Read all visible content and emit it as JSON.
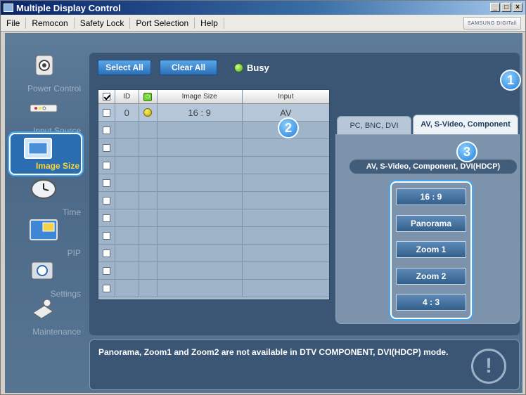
{
  "window": {
    "title": "Multiple Display Control"
  },
  "menu": [
    "File",
    "Remocon",
    "Safety Lock",
    "Port Selection",
    "Help"
  ],
  "brand": "SAMSUNG DIGITall",
  "sidebar": {
    "items": [
      {
        "label": "Power Control",
        "icon": "power-control-icon"
      },
      {
        "label": "Input Source",
        "icon": "input-source-icon"
      },
      {
        "label": "Image Size",
        "icon": "image-size-icon",
        "active": true
      },
      {
        "label": "Time",
        "icon": "clock-icon"
      },
      {
        "label": "PIP",
        "icon": "pip-icon"
      },
      {
        "label": "Settings",
        "icon": "settings-icon"
      },
      {
        "label": "Maintenance",
        "icon": "maintenance-icon"
      }
    ]
  },
  "toolbar": {
    "select_all": "Select All",
    "clear_all": "Clear All",
    "busy_label": "Busy"
  },
  "table": {
    "headers": [
      "ID",
      "Image Size",
      "Input"
    ],
    "rows": [
      {
        "checked": false,
        "id": "0",
        "status": "yellow",
        "image_size": "16 : 9",
        "input": "AV"
      }
    ],
    "empty_rows": 10
  },
  "tabs": [
    {
      "label": "PC, BNC, DVI",
      "active": false
    },
    {
      "label": "AV, S-Video, Component",
      "active": true
    }
  ],
  "panel": {
    "group_label": "AV, S-Video, Component, DVI(HDCP)",
    "options": [
      "16 : 9",
      "Panorama",
      "Zoom 1",
      "Zoom 2",
      "4 : 3"
    ]
  },
  "badges": [
    "1",
    "2",
    "3"
  ],
  "message": "Panorama, Zoom1 and Zoom2 are not available in DTV COMPONENT, DVI(HDCP) mode.",
  "colors": {
    "accent": "#3fa9f5",
    "panel": "#3a5674",
    "busy": "#4da820"
  }
}
